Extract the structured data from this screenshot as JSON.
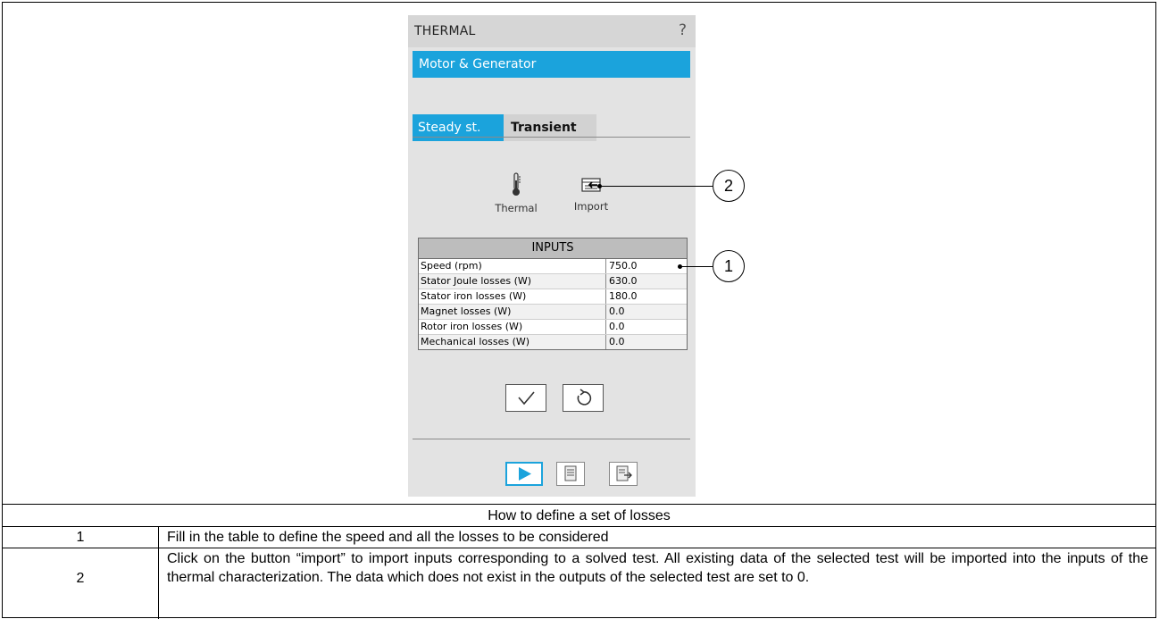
{
  "panel": {
    "title": "THERMAL",
    "help": "?",
    "module": "Motor & Generator",
    "tabs": {
      "steady": "Steady st.",
      "transient": "Transient"
    },
    "tools": {
      "thermal": "Thermal",
      "import": "Import"
    },
    "inputs_header": "INPUTS",
    "inputs": [
      {
        "label": "Speed (rpm)",
        "value": "750.0"
      },
      {
        "label": "Stator Joule losses (W)",
        "value": "630.0"
      },
      {
        "label": "Stator iron losses (W)",
        "value": "180.0"
      },
      {
        "label": "Magnet losses (W)",
        "value": "0.0"
      },
      {
        "label": "Rotor iron losses (W)",
        "value": "0.0"
      },
      {
        "label": "Mechanical losses (W)",
        "value": "0.0"
      }
    ],
    "accent_color": "#1ba3dc"
  },
  "callouts": {
    "one": "1",
    "two": "2"
  },
  "caption": "How to define a set of losses",
  "rows": [
    {
      "num": "1",
      "text": "Fill in the table to define the speed and all the losses to be considered"
    },
    {
      "num": "2",
      "text": "Click on the button “import” to import inputs corresponding to a solved test. All existing data of the selected test will be imported into the inputs of the thermal characterization. The data which does not exist in the outputs of the selected test are set to 0."
    }
  ]
}
